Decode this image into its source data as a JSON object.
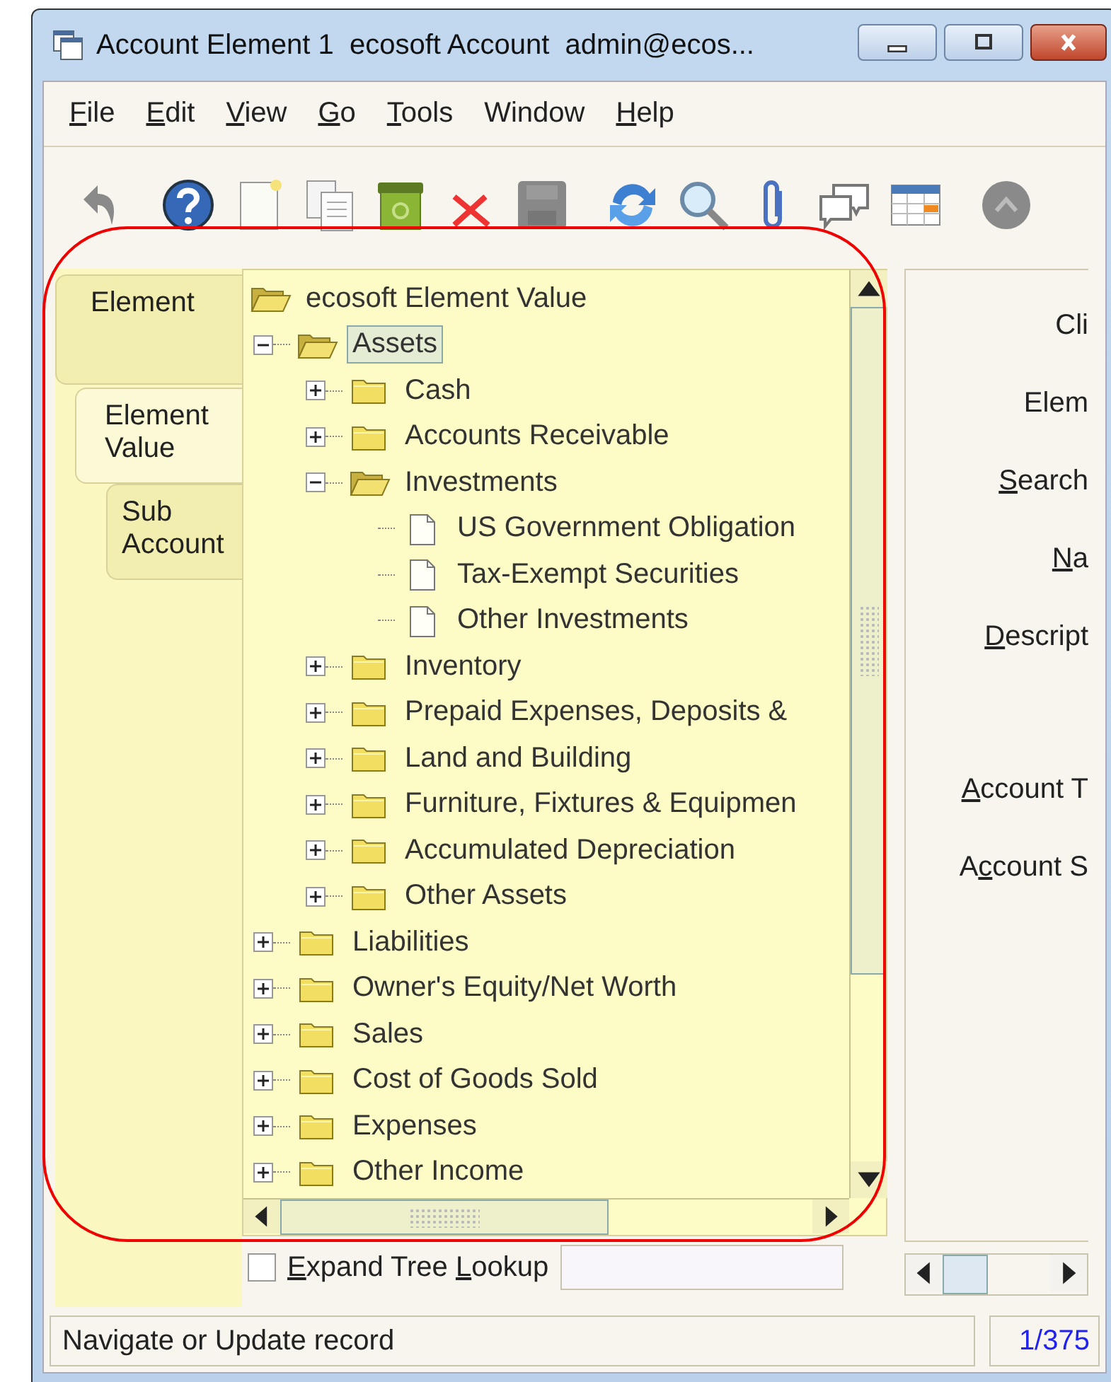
{
  "window": {
    "title": "Account Element 1  ecosoft Account  admin@ecos..."
  },
  "menu": [
    {
      "parts": [
        {
          "text": "F",
          "underline": true
        },
        {
          "text": "ile",
          "underline": false
        }
      ]
    },
    {
      "parts": [
        {
          "text": "E",
          "underline": true
        },
        {
          "text": "dit",
          "underline": false
        }
      ]
    },
    {
      "parts": [
        {
          "text": "V",
          "underline": true
        },
        {
          "text": "iew",
          "underline": false
        }
      ]
    },
    {
      "parts": [
        {
          "text": "G",
          "underline": true
        },
        {
          "text": "o",
          "underline": false
        }
      ]
    },
    {
      "parts": [
        {
          "text": "T",
          "underline": true
        },
        {
          "text": "ools",
          "underline": false
        }
      ]
    },
    {
      "parts": [
        {
          "text": "Window",
          "underline": false
        }
      ]
    },
    {
      "parts": [
        {
          "text": "H",
          "underline": true
        },
        {
          "text": "elp",
          "underline": false
        }
      ]
    }
  ],
  "tabs": [
    {
      "label": "Element",
      "selected": false,
      "children": [
        {
          "label": "Element Value",
          "selected": true,
          "children": [
            {
              "label": "Sub Account",
              "selected": false
            }
          ]
        }
      ]
    }
  ],
  "tree": {
    "label": "ecosoft Element Value",
    "kind": "folder",
    "expanded": true,
    "selected": false,
    "children": [
      {
        "label": "Assets",
        "kind": "folder",
        "expanded": true,
        "selected": true,
        "children": [
          {
            "label": "Cash",
            "kind": "folder",
            "expanded": false,
            "selected": false
          },
          {
            "label": "Accounts Receivable",
            "kind": "folder",
            "expanded": false,
            "selected": false
          },
          {
            "label": "Investments",
            "kind": "folder",
            "expanded": true,
            "selected": false,
            "children": [
              {
                "label": "US Government Obligation",
                "kind": "leaf",
                "selected": false
              },
              {
                "label": "Tax-Exempt Securities",
                "kind": "leaf",
                "selected": false
              },
              {
                "label": "Other Investments",
                "kind": "leaf",
                "selected": false
              }
            ]
          },
          {
            "label": "Inventory",
            "kind": "folder",
            "expanded": false,
            "selected": false
          },
          {
            "label": "Prepaid Expenses, Deposits &",
            "kind": "folder",
            "expanded": false,
            "selected": false
          },
          {
            "label": "Land and Building",
            "kind": "folder",
            "expanded": false,
            "selected": false
          },
          {
            "label": "Furniture, Fixtures & Equipmen",
            "kind": "folder",
            "expanded": false,
            "selected": false
          },
          {
            "label": "Accumulated Depreciation",
            "kind": "folder",
            "expanded": false,
            "selected": false
          },
          {
            "label": "Other Assets",
            "kind": "folder",
            "expanded": false,
            "selected": false
          }
        ]
      },
      {
        "label": "Liabilities",
        "kind": "folder",
        "expanded": false,
        "selected": false
      },
      {
        "label": "Owner's Equity/Net Worth",
        "kind": "folder",
        "expanded": false,
        "selected": false
      },
      {
        "label": "Sales",
        "kind": "folder",
        "expanded": false,
        "selected": false
      },
      {
        "label": "Cost of Goods Sold",
        "kind": "folder",
        "expanded": false,
        "selected": false
      },
      {
        "label": "Expenses",
        "kind": "folder",
        "expanded": false,
        "selected": false
      },
      {
        "label": "Other Income",
        "kind": "folder",
        "expanded": false,
        "selected": false
      }
    ]
  },
  "expand_tree_lookup": {
    "checked": false,
    "parts": [
      {
        "text": "E",
        "underline": true
      },
      {
        "text": "xpand Tree ",
        "underline": false
      },
      {
        "text": "L",
        "underline": true
      },
      {
        "text": "ookup",
        "underline": false
      }
    ]
  },
  "fields": [
    {
      "kind": "single",
      "parts": [
        {
          "text": "Cli",
          "underline": false
        }
      ]
    },
    {
      "kind": "single",
      "parts": [
        {
          "text": "Elem",
          "underline": false
        }
      ]
    },
    {
      "kind": "single",
      "parts": [
        {
          "text": "S",
          "underline": true
        },
        {
          "text": "earch",
          "underline": false
        }
      ]
    },
    {
      "kind": "single",
      "parts": [
        {
          "text": "N",
          "underline": true
        },
        {
          "text": "a",
          "underline": false
        }
      ]
    },
    {
      "kind": "multi",
      "parts": [
        {
          "text": "D",
          "underline": true
        },
        {
          "text": "escript",
          "underline": false
        }
      ]
    },
    {
      "kind": "single",
      "parts": [
        {
          "text": "A",
          "underline": true
        },
        {
          "text": "ccount T",
          "underline": false
        }
      ]
    },
    {
      "kind": "single",
      "parts": [
        {
          "text": "A",
          "underline": false
        },
        {
          "text": "c",
          "underline": true
        },
        {
          "text": "count S",
          "underline": false
        }
      ]
    }
  ],
  "status_bar": {
    "message": "Navigate or Update record",
    "record": "1/375"
  }
}
